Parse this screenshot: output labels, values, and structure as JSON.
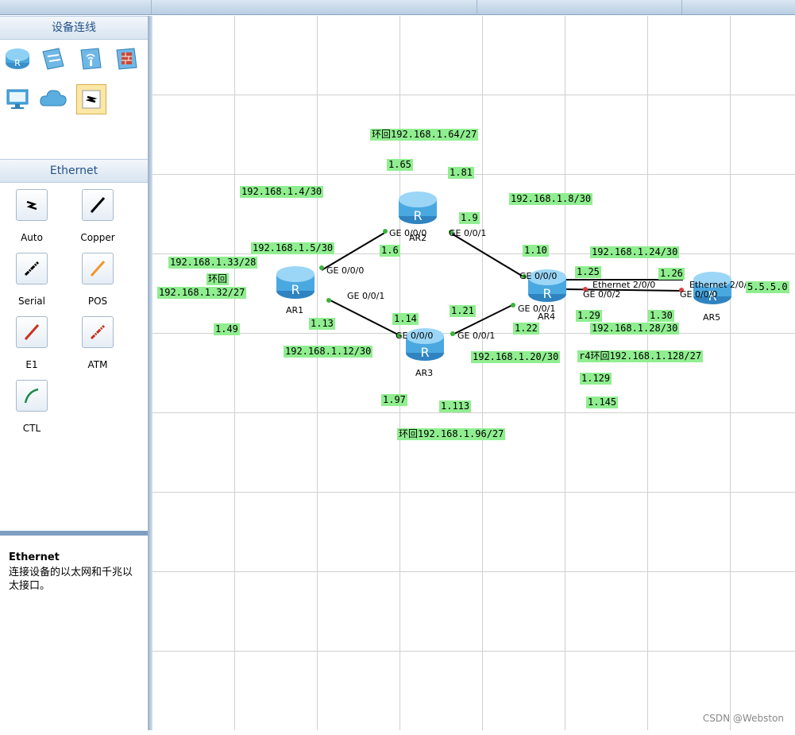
{
  "left_panel": {
    "device_header": "设备连线",
    "ethernet_header": "Ethernet",
    "device_icons": [
      "router-icon",
      "switch-icon",
      "wireless-icon",
      "firewall-icon",
      "pc-icon",
      "cloud-icon",
      "auto-connect-icon"
    ],
    "cables": [
      {
        "label": "Auto",
        "icon": "auto-cable-icon"
      },
      {
        "label": "Copper",
        "icon": "copper-cable-icon"
      },
      {
        "label": "Serial",
        "icon": "serial-cable-icon"
      },
      {
        "label": "POS",
        "icon": "pos-cable-icon"
      },
      {
        "label": "E1",
        "icon": "e1-cable-icon"
      },
      {
        "label": "ATM",
        "icon": "atm-cable-icon"
      },
      {
        "label": "CTL",
        "icon": "ctl-cable-icon"
      }
    ],
    "description": {
      "title": "Ethernet",
      "text": "连接设备的以太网和千兆以太接口。"
    }
  },
  "devices": [
    {
      "name": "AR1"
    },
    {
      "name": "AR2"
    },
    {
      "name": "AR3"
    },
    {
      "name": "AR4"
    },
    {
      "name": "AR5"
    }
  ],
  "ports": [
    "GE 0/0/0",
    "GE 0/0/1",
    "GE 0/0/0",
    "GE 0/0/1",
    "GE 0/0/0",
    "GE 0/0/1",
    "GE 0/0/0",
    "GE 0/0/1",
    "Ethernet 2/0/0",
    "GE 0/0/2",
    "Ethernet 2/0/0",
    "GE 0/0/0"
  ],
  "notes": [
    "环回192.168.1.64/27",
    "1.65",
    "1.81",
    "192.168.1.4/30",
    "192.168.1.8/30",
    "1.9",
    "192.168.1.5/30",
    "1.6",
    "1.10",
    "192.168.1.24/30",
    "192.168.1.33/28",
    "环回",
    "192.168.1.32/27",
    "1.25",
    "1.26",
    "5.5.5.0",
    "1.21",
    "1.14",
    "1.13",
    "1.49",
    "1.29",
    "1.30",
    "1.22",
    "192.168.1.28/30",
    "192.168.1.12/30",
    "192.168.1.20/30",
    "r4环回192.168.1.128/27",
    "1.129",
    "1.97",
    "1.113",
    "1.145",
    "环回192.168.1.96/27"
  ],
  "watermark": "CSDN @Webston",
  "colors": {
    "note_bg": "#90ee90",
    "router_blue": "#4aa8e0",
    "port_dot_green": "#3cb43c",
    "port_dot_red": "#e04040"
  }
}
